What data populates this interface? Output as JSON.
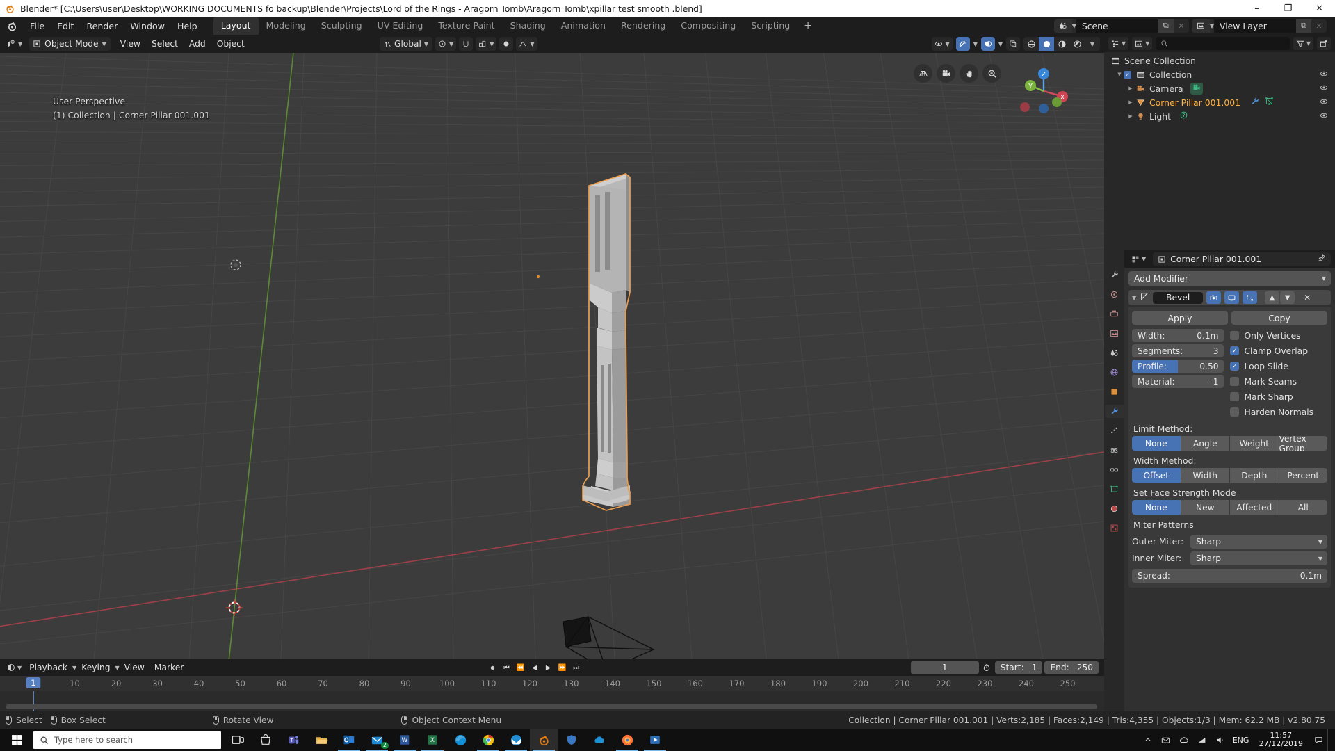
{
  "window": {
    "title": "Blender* [C:\\Users\\user\\Desktop\\WORKING DOCUMENTS fo backup\\Blender\\Projects\\Lord of the Rings - Aragorn Tomb\\Aragorn Tomb\\xpillar test smooth .blend]",
    "minimize": "–",
    "maximize": "❐",
    "close": "✕"
  },
  "topbar": {
    "menus": [
      "File",
      "Edit",
      "Render",
      "Window",
      "Help"
    ],
    "workspaces": [
      {
        "label": "Layout",
        "active": true
      },
      {
        "label": "Modeling",
        "active": false
      },
      {
        "label": "Sculpting",
        "active": false
      },
      {
        "label": "UV Editing",
        "active": false
      },
      {
        "label": "Texture Paint",
        "active": false
      },
      {
        "label": "Shading",
        "active": false
      },
      {
        "label": "Animation",
        "active": false
      },
      {
        "label": "Rendering",
        "active": false
      },
      {
        "label": "Compositing",
        "active": false
      },
      {
        "label": "Scripting",
        "active": false
      }
    ],
    "add_workspace": "+",
    "scene_name": "Scene",
    "view_layer_name": "View Layer"
  },
  "viewport": {
    "mode": "Object Mode",
    "menus": [
      "View",
      "Select",
      "Add",
      "Object"
    ],
    "transform_orientation": "Global",
    "overlay_line1": "User Perspective",
    "overlay_line2": "(1) Collection | Corner Pillar 001.001",
    "gizmo_axes": [
      "X",
      "Y",
      "Z"
    ],
    "nav_buttons": [
      "grid-toggle",
      "camera-view",
      "pan-view",
      "zoom-view"
    ]
  },
  "timeline": {
    "menus": [
      "Playback",
      "Keying",
      "View",
      "Marker"
    ],
    "current_frame": "1",
    "start_label": "Start:",
    "start_value": "1",
    "end_label": "End:",
    "end_value": "250",
    "ticks": [
      "1",
      "10",
      "20",
      "30",
      "40",
      "50",
      "60",
      "70",
      "80",
      "90",
      "100",
      "110",
      "120",
      "130",
      "140",
      "150",
      "160",
      "170",
      "180",
      "190",
      "200",
      "210",
      "220",
      "230",
      "240",
      "250"
    ],
    "playhead": "1"
  },
  "outliner": {
    "search_placeholder": "",
    "rows": [
      {
        "label": "Scene Collection",
        "indent": 0,
        "icon": "collection-icon",
        "selected": false,
        "tri": false,
        "check": false,
        "eye": false
      },
      {
        "label": "Collection",
        "indent": 1,
        "icon": "collection-icon",
        "selected": false,
        "tri": true,
        "check": true,
        "eye": true
      },
      {
        "label": "Camera",
        "indent": 2,
        "icon": "camera-icon",
        "selected": false,
        "tri": true,
        "check": false,
        "eye": true,
        "extra": [
          "camera-data-icon"
        ]
      },
      {
        "label": "Corner Pillar 001.001",
        "indent": 2,
        "icon": "mesh-object-icon",
        "selected": true,
        "tri": true,
        "check": false,
        "eye": true,
        "extra": [
          "modifier-wrench-icon",
          "mesh-data-icon"
        ]
      },
      {
        "label": "Light",
        "indent": 2,
        "icon": "light-icon",
        "selected": false,
        "tri": true,
        "check": false,
        "eye": true,
        "extra": [
          "light-data-icon"
        ]
      }
    ]
  },
  "properties": {
    "breadcrumb_object": "Corner Pillar 001.001",
    "add_modifier": "Add Modifier",
    "modifier": {
      "name": "Bevel",
      "apply_label": "Apply",
      "copy_label": "Copy",
      "toggles": [
        "render-toggle",
        "realtime-toggle",
        "edit-mode-toggle"
      ],
      "move_up": "▲",
      "move_down": "▼",
      "delete": "✕",
      "fields": [
        {
          "key": "Width:",
          "value": "0.1m",
          "highlight": false
        },
        {
          "key": "Segments:",
          "value": "3",
          "highlight": false
        },
        {
          "key": "Profile:",
          "value": "0.50",
          "highlight": true
        },
        {
          "key": "Material:",
          "value": "-1",
          "highlight": false
        }
      ],
      "checkboxes": [
        {
          "label": "Only Vertices",
          "checked": false
        },
        {
          "label": "Clamp Overlap",
          "checked": true
        },
        {
          "label": "Loop Slide",
          "checked": true
        },
        {
          "label": "Mark Seams",
          "checked": false
        },
        {
          "label": "Mark Sharp",
          "checked": false
        },
        {
          "label": "Harden Normals",
          "checked": false
        }
      ],
      "limit_method_label": "Limit Method:",
      "limit_method_options": [
        "None",
        "Angle",
        "Weight",
        "Vertex Group"
      ],
      "limit_method_active": "None",
      "width_method_label": "Width Method:",
      "width_method_options": [
        "Offset",
        "Width",
        "Depth",
        "Percent"
      ],
      "width_method_active": "Offset",
      "face_strength_label": "Set Face Strength Mode",
      "face_strength_options": [
        "None",
        "New",
        "Affected",
        "All"
      ],
      "face_strength_active": "None",
      "miter_label": "Miter Patterns",
      "outer_miter_label": "Outer Miter:",
      "outer_miter_value": "Sharp",
      "inner_miter_label": "Inner Miter:",
      "inner_miter_value": "Sharp",
      "spread_label": "Spread:",
      "spread_value": "0.1m"
    }
  },
  "statusbar": {
    "keymap": [
      {
        "label": "Select",
        "button": "left"
      },
      {
        "label": "Box Select",
        "button": "left-drag"
      },
      {
        "label": "Rotate View",
        "button": "middle"
      },
      {
        "label": "Object Context Menu",
        "button": "right"
      }
    ],
    "info": "Collection | Corner Pillar 001.001 | Verts:2,185 | Faces:2,149 | Tris:4,355 | Objects:1/3 | Mem: 62.2 MB | v2.80.75"
  },
  "taskbar": {
    "search_placeholder": "Type here to search",
    "apps": [
      {
        "name": "task-view-icon",
        "active": false
      },
      {
        "name": "store-icon",
        "active": false
      },
      {
        "name": "teams-icon",
        "active": false
      },
      {
        "name": "explorer-icon",
        "active": false
      },
      {
        "name": "outlook-icon",
        "active": true,
        "badge": ""
      },
      {
        "name": "mail-icon",
        "active": true,
        "badge": "2"
      },
      {
        "name": "word-icon",
        "active": true
      },
      {
        "name": "excel-icon",
        "active": true
      },
      {
        "name": "edge-icon",
        "active": false
      },
      {
        "name": "chrome-icon",
        "active": true
      },
      {
        "name": "thunderbird-icon",
        "active": true
      },
      {
        "name": "blender-icon",
        "active": true,
        "current": true
      },
      {
        "name": "shield-icon",
        "active": false
      },
      {
        "name": "onedrive-app-icon",
        "active": false
      },
      {
        "name": "firefox-icon",
        "active": true
      },
      {
        "name": "media-player-icon",
        "active": true
      }
    ],
    "tray_icons": [
      "chevron-up-icon",
      "mail-tray-icon",
      "onedrive-icon",
      "network-icon",
      "volume-icon"
    ],
    "language": "ENG",
    "time": "11:57",
    "date": "27/12/2019",
    "notification": "notification-icon"
  }
}
